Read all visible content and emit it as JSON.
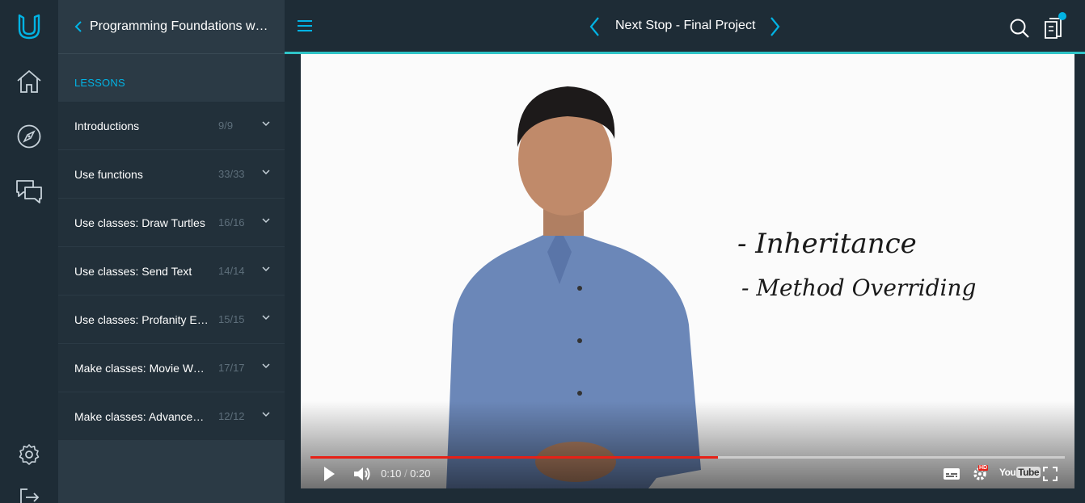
{
  "rail": {
    "items": [
      {
        "name": "udacity-logo-icon"
      },
      {
        "name": "home-icon"
      },
      {
        "name": "compass-icon"
      },
      {
        "name": "chat-icon"
      },
      {
        "name": "settings-icon"
      },
      {
        "name": "logout-icon"
      }
    ]
  },
  "sidebar": {
    "course_title": "Programming Foundations with Python",
    "section_label": "LESSONS",
    "lessons": [
      {
        "name": "Introductions",
        "count": "9/9"
      },
      {
        "name": "Use functions",
        "count": "33/33"
      },
      {
        "name": "Use classes: Draw Turtles",
        "count": "16/16"
      },
      {
        "name": "Use classes: Send Text",
        "count": "14/14"
      },
      {
        "name": "Use classes: Profanity Editor",
        "count": "15/15"
      },
      {
        "name": "Make classes: Movie Website",
        "count": "17/17"
      },
      {
        "name": "Make classes: Advanced Topics",
        "count": "12/12"
      }
    ]
  },
  "header": {
    "title": "Next Stop - Final Project",
    "accent_color": "#2fc4c7",
    "brand_color": "#02b3e4"
  },
  "video": {
    "whiteboard": {
      "line1": "- Inheritance",
      "line2": "- Method   Overriding"
    },
    "current_time": "0:10",
    "duration": "0:20",
    "progress": 0.54,
    "hd_badge": "HD",
    "youtube_label": "You",
    "youtube_tube": "Tube",
    "progress_color": "#e62117"
  }
}
